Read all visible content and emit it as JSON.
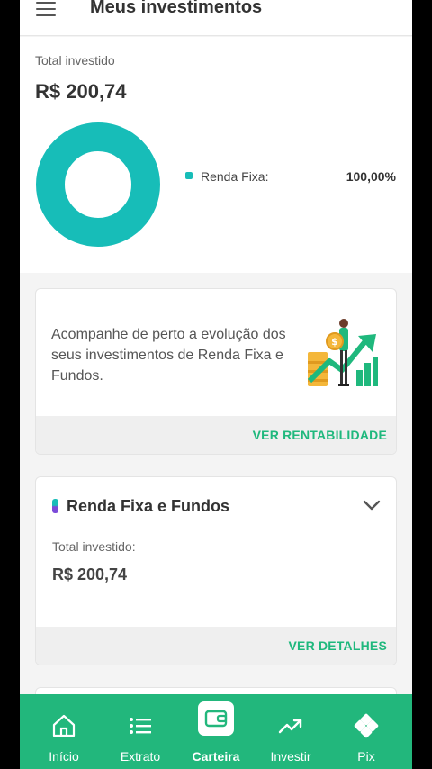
{
  "header": {
    "title": "Meus investimentos"
  },
  "summary": {
    "total_label": "Total investido",
    "total_value": "R$ 200,74",
    "legend": [
      {
        "label": "Renda Fixa:",
        "value": "100,00%",
        "color": "#17bdb8"
      }
    ]
  },
  "promo": {
    "text": "Acompanhe de perto a evolução dos seus investimentos de Renda Fixa e Fundos.",
    "link": "VER RENTABILIDADE"
  },
  "renda_fixa": {
    "title": "Renda Fixa e Fundos",
    "total_label": "Total investido:",
    "total_value": "R$ 200,74",
    "link": "VER DETALHES"
  },
  "nav": {
    "items": [
      {
        "label": "Início",
        "icon": "home-icon"
      },
      {
        "label": "Extrato",
        "icon": "list-icon"
      },
      {
        "label": "Carteira",
        "icon": "wallet-icon",
        "active": true
      },
      {
        "label": "Investir",
        "icon": "trending-up-icon"
      },
      {
        "label": "Pix",
        "icon": "pix-icon"
      }
    ]
  },
  "colors": {
    "brand_green": "#22b77c",
    "link_green": "#1fb87d",
    "teal": "#17bdb8"
  }
}
